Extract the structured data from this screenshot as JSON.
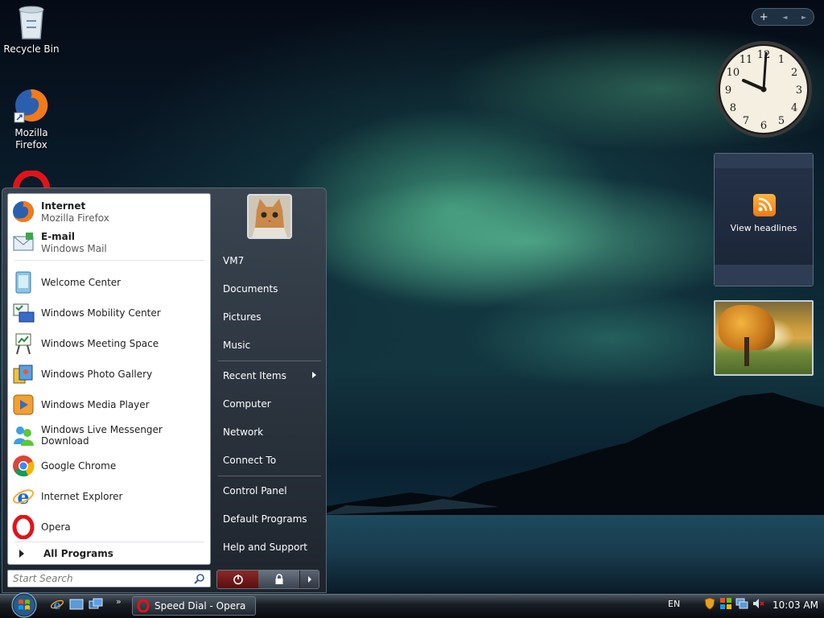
{
  "desktop": {
    "icons": [
      {
        "label": "Recycle Bin"
      },
      {
        "label": "Mozilla Firefox"
      }
    ]
  },
  "gadgets": {
    "toolbar": {
      "add_label": "+",
      "prev_label": "◄",
      "next_label": "►"
    },
    "clock": {
      "numbers": [
        "12",
        "1",
        "2",
        "3",
        "4",
        "5",
        "6",
        "7",
        "8",
        "9",
        "10",
        "11"
      ],
      "time": "10:03"
    },
    "feed": {
      "label": "View headlines",
      "icon": "rss-icon"
    },
    "photo": {
      "icon": "autumn-tree-photo"
    }
  },
  "start_menu": {
    "pinned": [
      {
        "name": "Internet",
        "sub": "Mozilla Firefox",
        "icon": "firefox-icon"
      },
      {
        "name": "E-mail",
        "sub": "Windows Mail",
        "icon": "mail-icon"
      }
    ],
    "recent": [
      {
        "label": "Welcome Center",
        "icon": "welcome-center-icon"
      },
      {
        "label": "Windows Mobility Center",
        "icon": "mobility-center-icon"
      },
      {
        "label": "Windows Meeting Space",
        "icon": "meeting-space-icon"
      },
      {
        "label": "Windows Photo Gallery",
        "icon": "photo-gallery-icon"
      },
      {
        "label": "Windows Media Player",
        "icon": "media-player-icon"
      },
      {
        "label": "Windows Live Messenger Download",
        "icon": "messenger-icon"
      },
      {
        "label": "Google Chrome",
        "icon": "chrome-icon"
      },
      {
        "label": "Internet Explorer",
        "icon": "ie-icon"
      },
      {
        "label": "Opera",
        "icon": "opera-icon"
      }
    ],
    "all_programs": "All Programs",
    "search_placeholder": "Start Search",
    "places": [
      {
        "label": "VM7"
      },
      {
        "label": "Documents"
      },
      {
        "label": "Pictures"
      },
      {
        "label": "Music"
      },
      {
        "label": "Recent Items"
      },
      {
        "label": "Computer"
      },
      {
        "label": "Network"
      },
      {
        "label": "Connect To"
      },
      {
        "label": "Control Panel"
      },
      {
        "label": "Default Programs"
      },
      {
        "label": "Help and Support"
      }
    ]
  },
  "taskbar": {
    "task": "Speed Dial - Opera",
    "quick_launch_more": "»",
    "language": "EN",
    "time": "10:03 AM"
  }
}
